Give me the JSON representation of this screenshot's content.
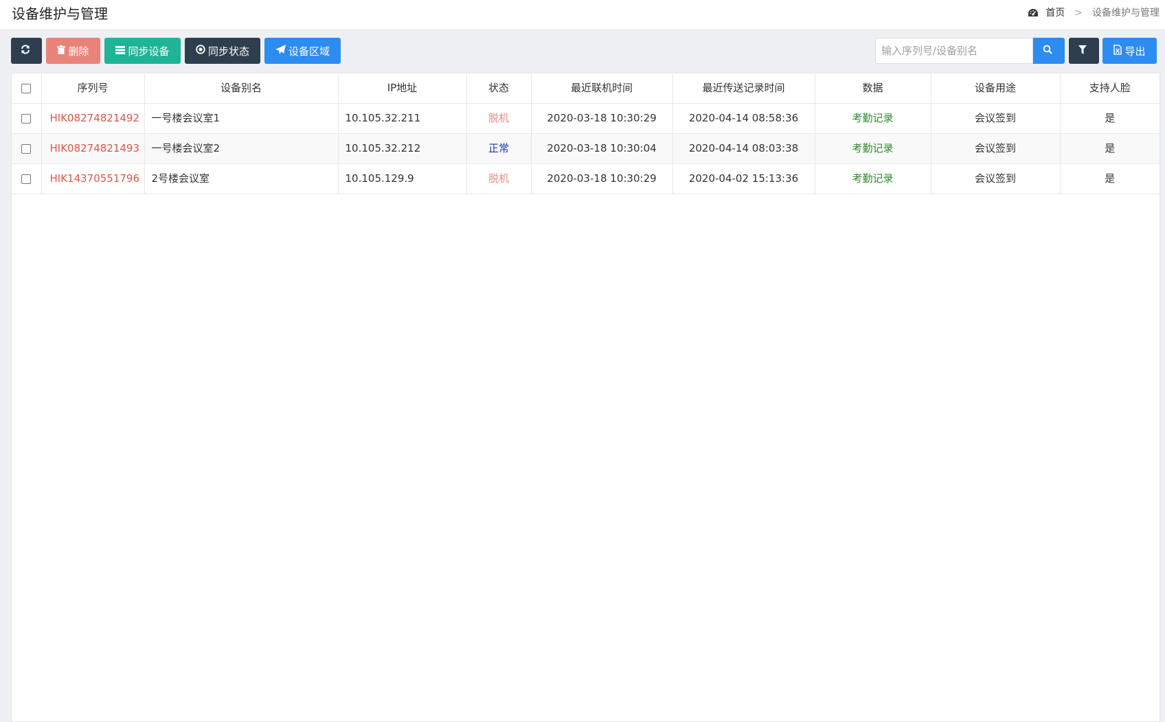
{
  "header": {
    "title": "设备维护与管理",
    "breadcrumb": {
      "home": "首页",
      "separator": ">",
      "current": "设备维护与管理"
    }
  },
  "toolbar": {
    "refresh_icon": "refresh-icon",
    "delete_label": "删除",
    "sync_devices_label": "同步设备",
    "sync_status_label": "同步状态",
    "device_area_label": "设备区域",
    "search_placeholder": "输入序列号/设备别名",
    "search_value": "",
    "export_label": "导出"
  },
  "colors": {
    "dark_button": "#2f3e4e",
    "delete_button": "#e9837a",
    "teal_button": "#1fb496",
    "blue_button": "#2d8cf0",
    "serial_text": "#e0554a",
    "offline_text": "#e98a80",
    "normal_text": "#1a3ab0",
    "data_link_text": "#2e8b2e"
  },
  "table": {
    "columns": [
      "序列号",
      "设备别名",
      "IP地址",
      "状态",
      "最近联机时间",
      "最近传送记录时间",
      "数据",
      "设备用途",
      "支持人脸"
    ],
    "rows": [
      {
        "serial": "HIK08274821492",
        "alias": "一号楼会议室1",
        "ip": "10.105.32.211",
        "status": "脱机",
        "last_online": "2020-03-18 10:30:29",
        "last_transfer": "2020-04-14 08:58:36",
        "data": "考勤记录",
        "purpose": "会议签到",
        "face": "是"
      },
      {
        "serial": "HIK08274821493",
        "alias": "一号楼会议室2",
        "ip": "10.105.32.212",
        "status": "正常",
        "last_online": "2020-03-18 10:30:04",
        "last_transfer": "2020-04-14 08:03:38",
        "data": "考勤记录",
        "purpose": "会议签到",
        "face": "是"
      },
      {
        "serial": "HIK14370551796",
        "alias": "2号楼会议室",
        "ip": "10.105.129.9",
        "status": "脱机",
        "last_online": "2020-03-18 10:30:29",
        "last_transfer": "2020-04-02 15:13:36",
        "data": "考勤记录",
        "purpose": "会议签到",
        "face": "是"
      }
    ]
  }
}
